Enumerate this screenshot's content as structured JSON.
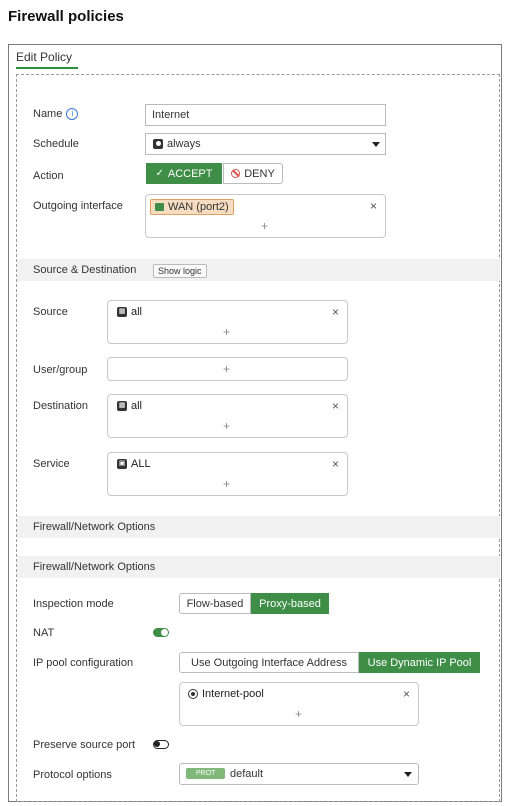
{
  "page": {
    "title": "Firewall policies"
  },
  "tab": {
    "label": "Edit Policy"
  },
  "labels": {
    "name": "Name",
    "schedule": "Schedule",
    "action": "Action",
    "outgoing_interface": "Outgoing interface",
    "source": "Source",
    "user_group": "User/group",
    "destination": "Destination",
    "service": "Service",
    "inspection_mode": "Inspection mode",
    "nat": "NAT",
    "ip_pool_configuration": "IP pool configuration",
    "preserve_source_port": "Preserve source port",
    "protocol_options": "Protocol options"
  },
  "sections": {
    "source_destination": "Source & Destination",
    "show_logic": "Show logic",
    "firewall_network_1": "Firewall/Network Options",
    "firewall_network_2": "Firewall/Network Options"
  },
  "fields": {
    "name_value": "Internet",
    "schedule_value": "always",
    "action_accept": "ACCEPT",
    "action_deny": "DENY",
    "outgoing_interface_value": "WAN (port2)",
    "source_value": "all",
    "destination_value": "all",
    "service_value": "ALL",
    "inspection_flow": "Flow-based",
    "inspection_proxy": "Proxy-based",
    "ip_pool_outgoing": "Use Outgoing Interface Address",
    "ip_pool_dynamic": "Use Dynamic IP Pool",
    "ip_pool_value": "Internet-pool",
    "protocol_badge": "PROT",
    "protocol_value": "default"
  },
  "state": {
    "action_selected": "ACCEPT",
    "inspection_selected": "Proxy-based",
    "ip_pool_selected": "Use Dynamic IP Pool",
    "nat_enabled": true,
    "preserve_source_port_enabled": false
  },
  "icons": {
    "info": "info-icon",
    "schedule": "schedule-icon",
    "dropdown": "chevron-down-icon",
    "accept": "check-icon",
    "deny": "deny-icon",
    "interface": "interface-icon",
    "address": "address-icon",
    "service": "service-icon",
    "ippool": "ippool-icon",
    "remove": "close-icon",
    "add": "plus-icon"
  },
  "colors": {
    "accent": "#3e8e47",
    "interface_chip": "#f6dcc0",
    "interface_border": "#e0a060",
    "deny": "#d9534f"
  }
}
